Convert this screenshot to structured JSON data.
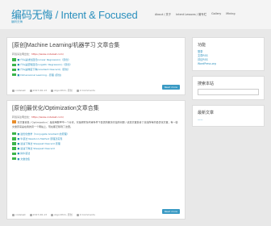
{
  "header": {
    "title": "编码无悔 / Intent & Focused",
    "tagline": "编码无悔",
    "nav": [
      "About / 关于",
      "Intent Lessons / 微专栏",
      "Gallery",
      "Mining"
    ]
  },
  "post1": {
    "title": "[原创]Machine Learning/机器学习 文章合集",
    "meta_prefix": "转载请注明出处：",
    "meta_url": "https://www.codelast.com/",
    "lines": [
      {
        "color": "g",
        "text": "■ 什么是线性回归(Linear Regression)（原创）"
      },
      {
        "color": "g",
        "text": "■ 什么是逻辑回归(Logistic Regression)（原创）"
      },
      {
        "color": "g",
        "text": "■ 什么是梯度下降(Gradient Descent)（原创）"
      },
      {
        "color": "g",
        "text": "■ Dimensional Learning - 原理 (原创)"
      }
    ],
    "readmore": "Read more",
    "footer": [
      "codelast",
      "2017-06-13",
      "Algorithm, 原创",
      "0 Comments"
    ]
  },
  "post2": {
    "title": "[原创]最优化/Optimization文章合集",
    "meta_prefix": "转载请注明出处：",
    "meta_url": "https://www.codelast.com/",
    "paragraph": "本文章合集 / Optimization：是应用数学中一个分支，它是研究在约束条件下最优的解决方案的问题 / 这篇文章集合了本站所有的最优化文章，有一些文章原来是在我的另一个网站上，现在都迁移到了这里。",
    "lines": [
      {
        "color": "g",
        "text": "■ 最优化数学（Conjugate Gradient 的原理）"
      },
      {
        "color": "g",
        "text": "■ 牛顿法 Newton's Method 原理及实现"
      },
      {
        "color": "g",
        "text": "■ 最速下降法 Steepest Descent 原理"
      },
      {
        "color": "g",
        "text": "■ 最速下降法 Steepest Descent"
      },
      {
        "color": "g",
        "text": "■ 拟牛顿法"
      },
      {
        "color": "g",
        "text": "■ 文章合集"
      }
    ],
    "readmore": "Read more",
    "footer": [
      "codelast",
      "2017-06-13",
      "Algorithm, 原创",
      "0 Comments"
    ]
  },
  "sidebar": {
    "func_title": "功能",
    "func_links": [
      "登录",
      "文章RSS",
      "评论RSS",
      "WordPress.org"
    ],
    "search_title": "搜索本站",
    "recent_title": "最新文章",
    "recent_links": [
      "——"
    ]
  }
}
